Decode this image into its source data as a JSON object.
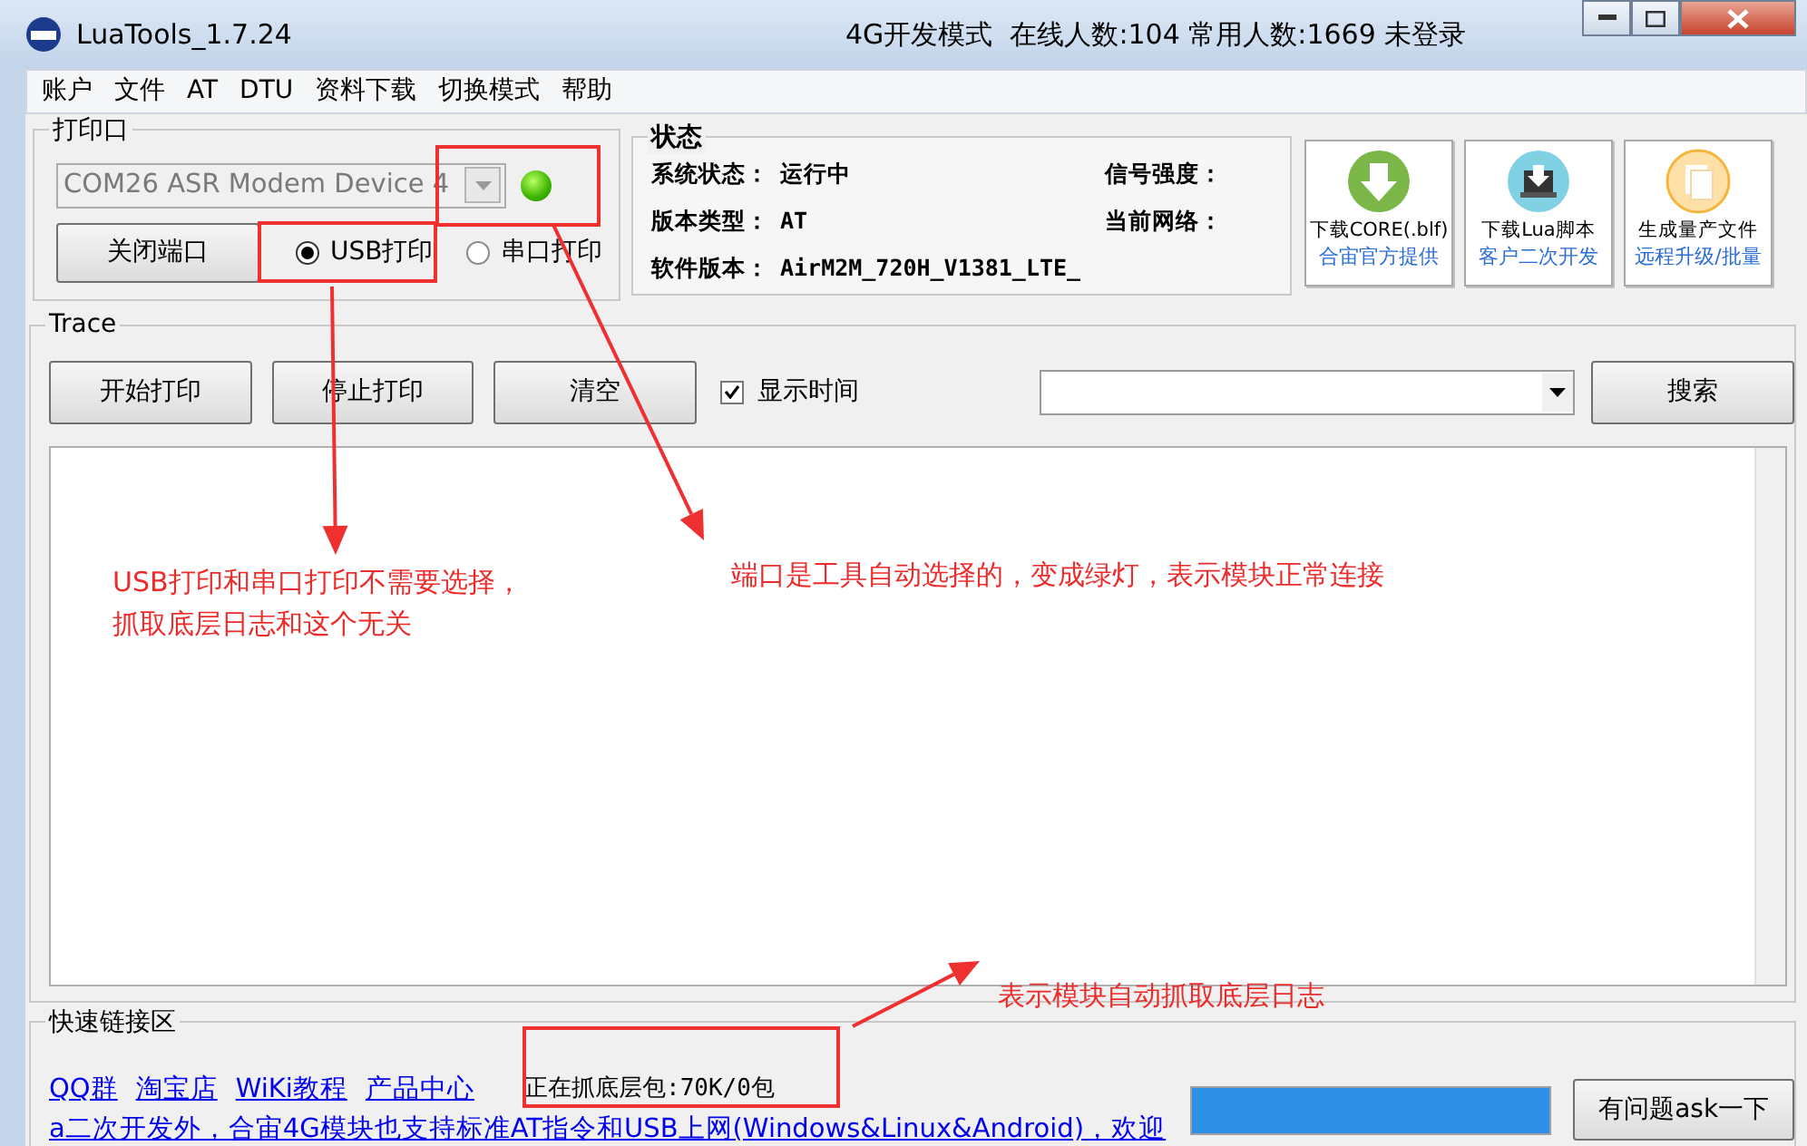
{
  "window": {
    "title": "LuaTools_1.7.24",
    "header_info": "4G开发模式  在线人数:104 常用人数:1669 未登录"
  },
  "menu": [
    "账户",
    "文件",
    "AT",
    "DTU",
    "资料下载",
    "切换模式",
    "帮助"
  ],
  "port_group": {
    "title": "打印口",
    "port": {
      "value": "COM26 ASR Modem Device 4",
      "disabled": true
    },
    "connected": true,
    "close_button": "关闭端口",
    "print_modes": [
      {
        "label": "USB打印",
        "selected": true
      },
      {
        "label": "串口打印",
        "selected": false
      }
    ]
  },
  "status_group": {
    "title": "状态",
    "left_fields": [
      {
        "label": "系统状态：",
        "value": "运行中"
      },
      {
        "label": "版本类型：",
        "value": "AT"
      },
      {
        "label": "软件版本：",
        "value": "AirM2M_720H_V1381_LTE_"
      }
    ],
    "right_fields": [
      {
        "label": "信号强度："
      },
      {
        "label": "当前网络："
      }
    ]
  },
  "tools": [
    {
      "kind": "download",
      "title": "下载CORE(.blf)",
      "subtitle": "合宙官方提供"
    },
    {
      "kind": "script",
      "title": "下载Lua脚本",
      "subtitle": "客户二次开发"
    },
    {
      "kind": "file",
      "title": "生成量产文件",
      "subtitle": "远程升级/批量"
    }
  ],
  "trace": {
    "title": "Trace",
    "buttons": [
      "开始打印",
      "停止打印",
      "清空"
    ],
    "show_time": {
      "label": "显示时间",
      "checked": true
    },
    "search_button": "搜索"
  },
  "quick_links": {
    "title": "快速链接区",
    "links": [
      "QQ群",
      "淘宝店",
      "WiKi教程",
      "产品中心"
    ],
    "ticker": "a二次开发外，合宙4G模块也支持标准AT指令和USB上网(Windows&Linux&Android)，欢迎",
    "capture_status": "正在抓底层包:70K/0包",
    "progress": {
      "level": 1
    },
    "ask_button": "有问题ask一下"
  },
  "annotations": [
    "USB打印和串口打印不需要选择，",
    "抓取底层日志和这个无关",
    "端口是工具自动选择的，变成绿灯，表示模块正常连接",
    "表示模块自动抓取底层日志"
  ]
}
